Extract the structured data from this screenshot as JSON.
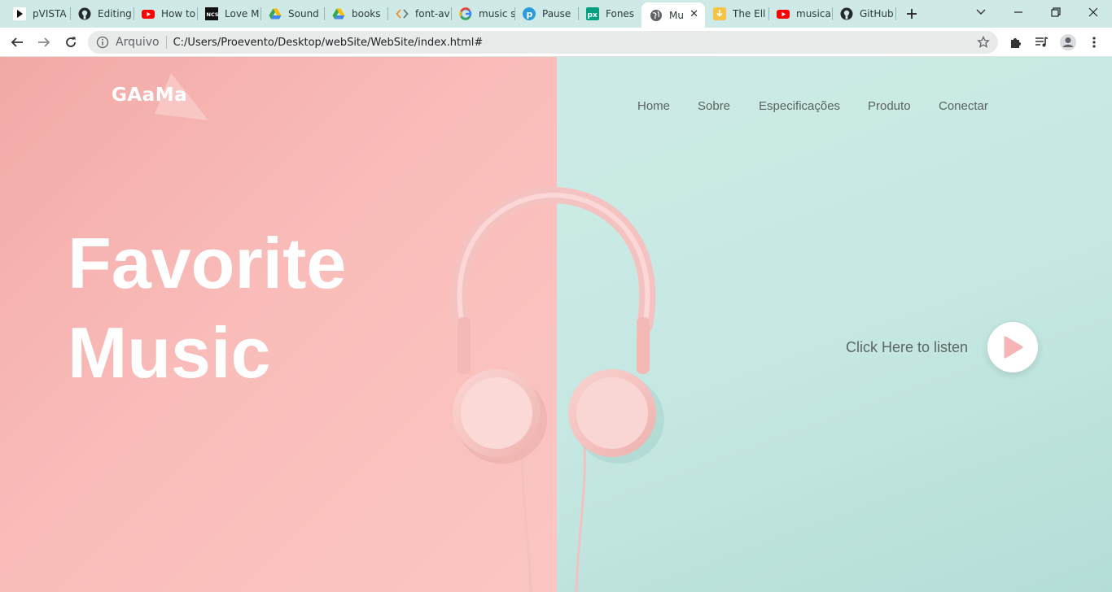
{
  "browser": {
    "tabs": [
      {
        "title": "pVISTA",
        "icon": "pvista-icon"
      },
      {
        "title": "Editing",
        "icon": "github-icon"
      },
      {
        "title": "How to",
        "icon": "youtube-icon"
      },
      {
        "title": "Love M",
        "icon": "ncs-icon"
      },
      {
        "title": "Sound",
        "icon": "google-drive-icon"
      },
      {
        "title": "books",
        "icon": "google-drive-icon"
      },
      {
        "title": "font-av",
        "icon": "code-icon"
      },
      {
        "title": "music s",
        "icon": "google-icon"
      },
      {
        "title": "Pause",
        "icon": "pause-icon"
      },
      {
        "title": "Fones",
        "icon": "pexels-icon"
      },
      {
        "title": "Mu",
        "icon": "globe-icon",
        "active": true
      },
      {
        "title": "The Ell",
        "icon": "download-icon"
      },
      {
        "title": "musica",
        "icon": "youtube-icon"
      },
      {
        "title": "GitHub",
        "icon": "github-icon"
      }
    ],
    "address": {
      "scheme_label": "Arquivo",
      "url": "C:/Users/Proevento/Desktop/webSite/WebSite/index.html#"
    }
  },
  "site": {
    "logo": "GAaMa",
    "nav": [
      "Home",
      "Sobre",
      "Especificações",
      "Produto",
      "Conectar"
    ],
    "headline_line1": "Favorite",
    "headline_line2": "Music",
    "cta_label": "Click Here to listen",
    "colors": {
      "left_bg": "#f9bcb9",
      "right_bg": "#c6e8e2",
      "play_triangle": "#f7b3b5"
    }
  }
}
